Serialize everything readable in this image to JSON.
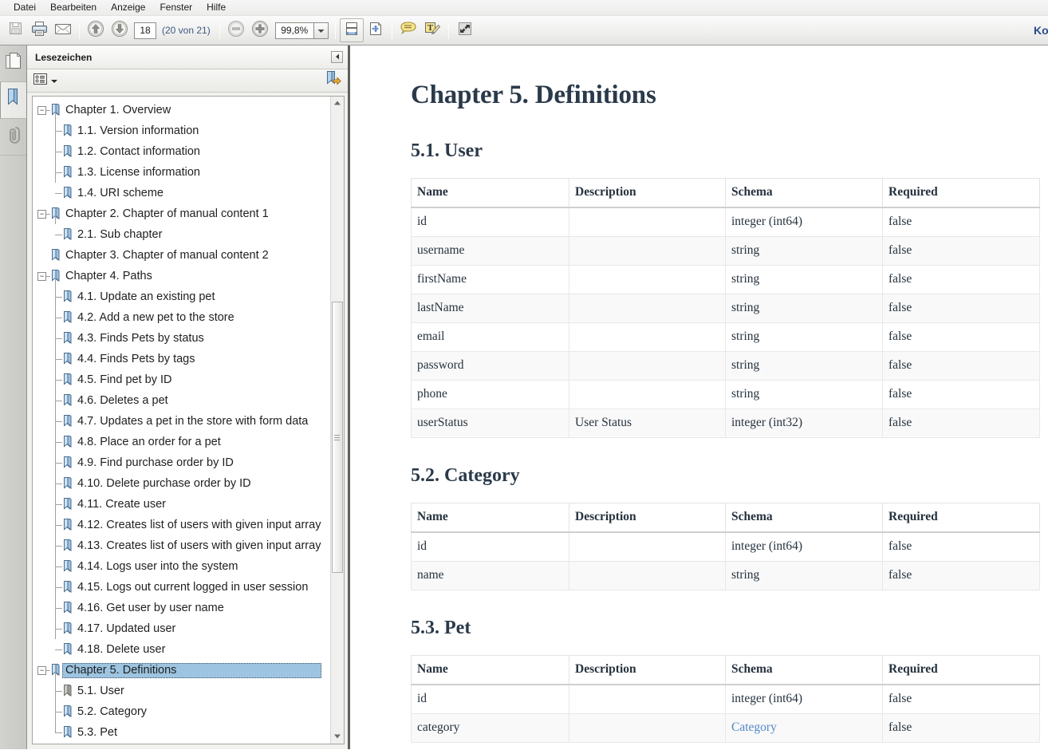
{
  "menubar": {
    "items": [
      {
        "label": "Datei"
      },
      {
        "label": "Bearbeiten"
      },
      {
        "label": "Anzeige"
      },
      {
        "label": "Fenster"
      },
      {
        "label": "Hilfe"
      }
    ]
  },
  "toolbar": {
    "save_icon": "save-floppy-icon",
    "print_icon": "printer-icon",
    "email_icon": "email-envelope-icon",
    "prev_page_icon": "arrow-up-circle-icon",
    "next_page_icon": "arrow-down-circle-icon",
    "page_number": "18",
    "page_counter": "(20 von 21)",
    "zoom_out_icon": "minus-circle-icon",
    "zoom_in_icon": "plus-circle-icon",
    "zoom_value": "99,8%",
    "zoom_dropdown_icon": "chevron-down-icon",
    "fit_width_icon": "fit-page-width-icon",
    "fit_page_icon": "fit-whole-page-icon",
    "comment_icon": "speech-bubble-comment-icon",
    "highlight_icon": "text-highlight-pen-icon",
    "fullscreen_icon": "fullscreen-expand-icon",
    "right_truncated_label": "Kommentar"
  },
  "rail": {
    "pages_icon": "pages-thumbnails-icon",
    "bookmarks_icon": "bookmark-ribbon-icon",
    "attachments_icon": "paperclip-attachment-icon"
  },
  "sidebar": {
    "title": "Lesezeichen",
    "collapse_icon": "collapse-panel-left-icon",
    "options_icon": "list-options-icon",
    "options_caret_icon": "caret-down-icon",
    "expand_current_icon": "bookmark-jump-arrow-icon",
    "scroll_up_icon": "scroll-arrow-up-icon",
    "scroll_down_icon": "scroll-arrow-down-icon",
    "tree": [
      {
        "label": "Chapter 1. Overview",
        "level": 0,
        "toggle": "minus",
        "selected": false
      },
      {
        "label": "1.1. Version information",
        "level": 1,
        "toggle": "none",
        "selected": false
      },
      {
        "label": "1.2. Contact information",
        "level": 1,
        "toggle": "none",
        "selected": false
      },
      {
        "label": "1.3. License information",
        "level": 1,
        "toggle": "none",
        "selected": false
      },
      {
        "label": "1.4. URI scheme",
        "level": 1,
        "toggle": "none",
        "selected": false,
        "last": true
      },
      {
        "label": "Chapter 2. Chapter of manual content 1",
        "level": 0,
        "toggle": "minus",
        "selected": false
      },
      {
        "label": "2.1. Sub chapter",
        "level": 1,
        "toggle": "none",
        "selected": false,
        "last": true
      },
      {
        "label": "Chapter 3. Chapter of manual content 2",
        "level": 0,
        "toggle": "none",
        "selected": false
      },
      {
        "label": "Chapter 4. Paths",
        "level": 0,
        "toggle": "minus",
        "selected": false
      },
      {
        "label": "4.1. Update an existing pet",
        "level": 1,
        "toggle": "none",
        "selected": false
      },
      {
        "label": "4.2. Add a new pet to the store",
        "level": 1,
        "toggle": "none",
        "selected": false
      },
      {
        "label": "4.3. Finds Pets by status",
        "level": 1,
        "toggle": "none",
        "selected": false
      },
      {
        "label": "4.4. Finds Pets by tags",
        "level": 1,
        "toggle": "none",
        "selected": false
      },
      {
        "label": "4.5. Find pet by ID",
        "level": 1,
        "toggle": "none",
        "selected": false
      },
      {
        "label": "4.6. Deletes a pet",
        "level": 1,
        "toggle": "none",
        "selected": false
      },
      {
        "label": "4.7. Updates a pet in the store with form data",
        "level": 1,
        "toggle": "none",
        "selected": false
      },
      {
        "label": "4.8. Place an order for a pet",
        "level": 1,
        "toggle": "none",
        "selected": false
      },
      {
        "label": "4.9. Find purchase order by ID",
        "level": 1,
        "toggle": "none",
        "selected": false
      },
      {
        "label": "4.10. Delete purchase order by ID",
        "level": 1,
        "toggle": "none",
        "selected": false
      },
      {
        "label": "4.11. Create user",
        "level": 1,
        "toggle": "none",
        "selected": false
      },
      {
        "label": "4.12. Creates list of users with given input array",
        "level": 1,
        "toggle": "none",
        "selected": false
      },
      {
        "label": "4.13. Creates list of users with given input array",
        "level": 1,
        "toggle": "none",
        "selected": false
      },
      {
        "label": "4.14. Logs user into the system",
        "level": 1,
        "toggle": "none",
        "selected": false
      },
      {
        "label": "4.15. Logs out current logged in user session",
        "level": 1,
        "toggle": "none",
        "selected": false
      },
      {
        "label": "4.16. Get user by user name",
        "level": 1,
        "toggle": "none",
        "selected": false
      },
      {
        "label": "4.17. Updated user",
        "level": 1,
        "toggle": "none",
        "selected": false
      },
      {
        "label": "4.18. Delete user",
        "level": 1,
        "toggle": "none",
        "selected": false,
        "last": true
      },
      {
        "label": "Chapter 5. Definitions",
        "level": 0,
        "toggle": "minus",
        "selected": true
      },
      {
        "label": "5.1. User",
        "level": 1,
        "toggle": "none",
        "selected": false,
        "visited": true
      },
      {
        "label": "5.2. Category",
        "level": 1,
        "toggle": "none",
        "selected": false
      },
      {
        "label": "5.3. Pet",
        "level": 1,
        "toggle": "none",
        "selected": false
      }
    ]
  },
  "document": {
    "title": "Chapter 5. Definitions",
    "columns": [
      "Name",
      "Description",
      "Schema",
      "Required"
    ],
    "sections": [
      {
        "heading": "5.1. User",
        "rows": [
          {
            "name": "id",
            "description": "",
            "schema": "integer (int64)",
            "required": "false"
          },
          {
            "name": "username",
            "description": "",
            "schema": "string",
            "required": "false"
          },
          {
            "name": "firstName",
            "description": "",
            "schema": "string",
            "required": "false"
          },
          {
            "name": "lastName",
            "description": "",
            "schema": "string",
            "required": "false"
          },
          {
            "name": "email",
            "description": "",
            "schema": "string",
            "required": "false"
          },
          {
            "name": "password",
            "description": "",
            "schema": "string",
            "required": "false"
          },
          {
            "name": "phone",
            "description": "",
            "schema": "string",
            "required": "false"
          },
          {
            "name": "userStatus",
            "description": "User Status",
            "schema": "integer (int32)",
            "required": "false"
          }
        ]
      },
      {
        "heading": "5.2. Category",
        "rows": [
          {
            "name": "id",
            "description": "",
            "schema": "integer (int64)",
            "required": "false"
          },
          {
            "name": "name",
            "description": "",
            "schema": "string",
            "required": "false"
          }
        ]
      },
      {
        "heading": "5.3. Pet",
        "rows": [
          {
            "name": "id",
            "description": "",
            "schema": "integer (int64)",
            "required": "false"
          },
          {
            "name": "category",
            "description": "",
            "schema": "Category",
            "schema_link": true,
            "required": "false"
          }
        ]
      }
    ]
  },
  "colors": {
    "link": "#5488c7",
    "heading": "#2b3a4a",
    "selection": "#9dc4e0",
    "page_label": "#3d5a80"
  }
}
